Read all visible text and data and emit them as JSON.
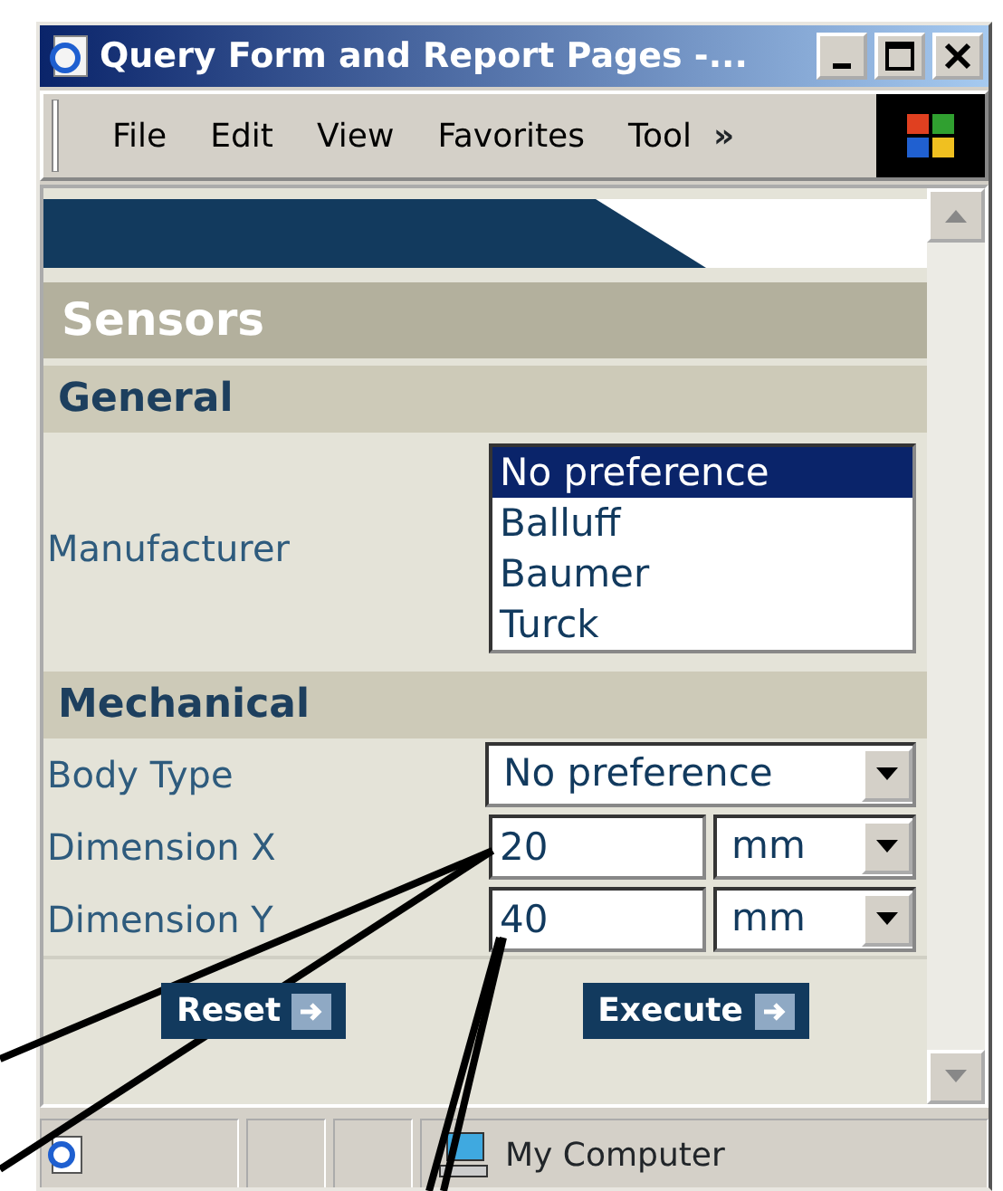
{
  "window": {
    "title": "Query Form and Report Pages -..."
  },
  "menu": [
    "File",
    "Edit",
    "View",
    "Favorites",
    "Tool"
  ],
  "menu_overflow": "»",
  "page": {
    "title": "Sensors",
    "sections": [
      {
        "title": "General",
        "fields": [
          {
            "kind": "listbox",
            "label": "Manufacturer",
            "options": [
              {
                "label": "No preference",
                "selected": true
              },
              {
                "label": "Balluff",
                "selected": false
              },
              {
                "label": "Baumer",
                "selected": false
              },
              {
                "label": "Turck",
                "selected": false
              }
            ]
          }
        ]
      },
      {
        "title": "Mechanical",
        "fields": [
          {
            "kind": "select",
            "label": "Body Type",
            "value": "No preference"
          },
          {
            "kind": "number",
            "label": "Dimension X",
            "value": "20",
            "unit": "mm"
          },
          {
            "kind": "number",
            "label": "Dimension Y",
            "value": "40",
            "unit": "mm"
          }
        ]
      }
    ],
    "buttons": [
      "Reset",
      "Execute"
    ]
  },
  "status_bar": {
    "zone": "My Computer"
  }
}
